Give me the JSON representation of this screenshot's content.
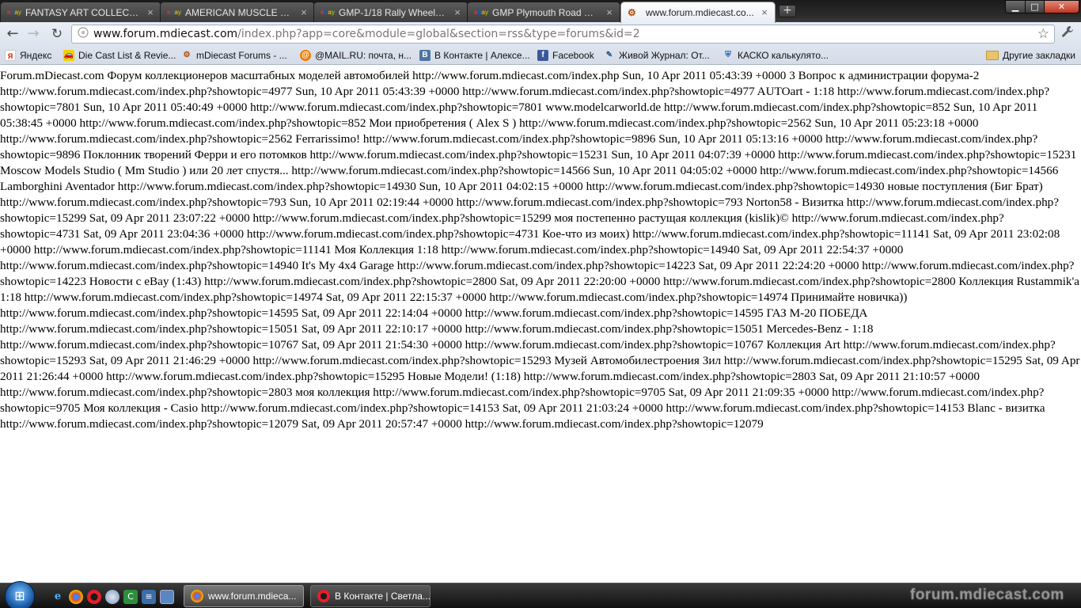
{
  "browser": {
    "tabs": [
      {
        "title": "FANTASY ART COLLECTI...",
        "favicon": "ebay-icon"
      },
      {
        "title": "AMERICAN MUSCLE 197...",
        "favicon": "ebay-icon"
      },
      {
        "title": "GMP-1/18 Rally Wheel & ...",
        "favicon": "ebay-icon"
      },
      {
        "title": "GMP Plymouth Road Ru...",
        "favicon": "ebay-icon"
      },
      {
        "title": "www.forum.mdiecast.co...",
        "favicon": "mdiecast-icon",
        "active": true
      }
    ],
    "tab_close_glyph": "×",
    "new_tab_glyph": "+",
    "window_controls": {
      "minimize": "▁",
      "maximize": "□",
      "close": "✕"
    },
    "toolbar": {
      "back_glyph": "←",
      "forward_glyph": "→",
      "reload_glyph": "↻",
      "url_host": "www.forum.mdiecast.com",
      "url_path": "/index.php?app=core&module=global&section=rss&type=forums&id=2",
      "star_glyph": "☆",
      "wrench_glyph": "🔧"
    },
    "bookmarks": [
      {
        "label": "Яндекс",
        "icon": "yandex-icon",
        "glyph": "Я"
      },
      {
        "label": "Die Cast List & Revie...",
        "icon": "car-icon",
        "glyph": "🚗"
      },
      {
        "label": "mDiecast Forums - ...",
        "icon": "mdiecast-icon",
        "glyph": "⚙"
      },
      {
        "label": "@MAIL.RU: почта, н...",
        "icon": "mailru-icon",
        "glyph": "@"
      },
      {
        "label": "В Контакте | Алексе...",
        "icon": "vk-icon",
        "glyph": "B"
      },
      {
        "label": "Facebook",
        "icon": "facebook-icon",
        "glyph": "f"
      },
      {
        "label": "Живой Журнал: От...",
        "icon": "livejournal-icon",
        "glyph": "✎"
      },
      {
        "label": "КАСКО калькулято...",
        "icon": "kasko-icon",
        "glyph": "⛨"
      }
    ],
    "other_bookmarks": "Другие закладки"
  },
  "page": {
    "rss_text": "Forum.mDiecast.com Форум коллекционеров масштабных моделей автомобилей http://www.forum.mdiecast.com/index.php Sun, 10 Apr 2011 05:43:39 +0000 3 Вопрос к администрации форума-2 http://www.forum.mdiecast.com/index.php?showtopic=4977 Sun, 10 Apr 2011 05:43:39 +0000 http://www.forum.mdiecast.com/index.php?showtopic=4977 AUTOart - 1:18 http://www.forum.mdiecast.com/index.php?showtopic=7801 Sun, 10 Apr 2011 05:40:49 +0000 http://www.forum.mdiecast.com/index.php?showtopic=7801 www.modelcarworld.de http://www.forum.mdiecast.com/index.php?showtopic=852 Sun, 10 Apr 2011 05:38:45 +0000 http://www.forum.mdiecast.com/index.php?showtopic=852 Мои приобретения ( Alex S ) http://www.forum.mdiecast.com/index.php?showtopic=2562 Sun, 10 Apr 2011 05:23:18 +0000 http://www.forum.mdiecast.com/index.php?showtopic=2562 Ferrarissimo! http://www.forum.mdiecast.com/index.php?showtopic=9896 Sun, 10 Apr 2011 05:13:16 +0000 http://www.forum.mdiecast.com/index.php?showtopic=9896 Поклонник творений Ферри и его потомков http://www.forum.mdiecast.com/index.php?showtopic=15231 Sun, 10 Apr 2011 04:07:39 +0000 http://www.forum.mdiecast.com/index.php?showtopic=15231 Moscow Models Studio ( Mm Studio ) или 20 лет спустя... http://www.forum.mdiecast.com/index.php?showtopic=14566 Sun, 10 Apr 2011 04:05:02 +0000 http://www.forum.mdiecast.com/index.php?showtopic=14566 Lamborghini Aventador http://www.forum.mdiecast.com/index.php?showtopic=14930 Sun, 10 Apr 2011 04:02:15 +0000 http://www.forum.mdiecast.com/index.php?showtopic=14930 новые поступления (Биг Брат) http://www.forum.mdiecast.com/index.php?showtopic=793 Sun, 10 Apr 2011 02:19:44 +0000 http://www.forum.mdiecast.com/index.php?showtopic=793 Norton58 - Визитка http://www.forum.mdiecast.com/index.php?showtopic=15299 Sat, 09 Apr 2011 23:07:22 +0000 http://www.forum.mdiecast.com/index.php?showtopic=15299 моя постепенно растущая коллекция (kislik)© http://www.forum.mdiecast.com/index.php?showtopic=4731 Sat, 09 Apr 2011 23:04:36 +0000 http://www.forum.mdiecast.com/index.php?showtopic=4731 Кое-что из моих) http://www.forum.mdiecast.com/index.php?showtopic=11141 Sat, 09 Apr 2011 23:02:08 +0000 http://www.forum.mdiecast.com/index.php?showtopic=11141 Моя Коллекция 1:18 http://www.forum.mdiecast.com/index.php?showtopic=14940 Sat, 09 Apr 2011 22:54:37 +0000 http://www.forum.mdiecast.com/index.php?showtopic=14940 It's My 4x4 Garage http://www.forum.mdiecast.com/index.php?showtopic=14223 Sat, 09 Apr 2011 22:24:20 +0000 http://www.forum.mdiecast.com/index.php?showtopic=14223 Новости с eBay (1:43) http://www.forum.mdiecast.com/index.php?showtopic=2800 Sat, 09 Apr 2011 22:20:00 +0000 http://www.forum.mdiecast.com/index.php?showtopic=2800 Коллекция Rustammik'a 1:18 http://www.forum.mdiecast.com/index.php?showtopic=14974 Sat, 09 Apr 2011 22:15:37 +0000 http://www.forum.mdiecast.com/index.php?showtopic=14974 Принимайте новичка)) http://www.forum.mdiecast.com/index.php?showtopic=14595 Sat, 09 Apr 2011 22:14:04 +0000 http://www.forum.mdiecast.com/index.php?showtopic=14595 ГАЗ М-20 ПОБЕДА http://www.forum.mdiecast.com/index.php?showtopic=15051 Sat, 09 Apr 2011 22:10:17 +0000 http://www.forum.mdiecast.com/index.php?showtopic=15051 Mercedes-Benz - 1:18 http://www.forum.mdiecast.com/index.php?showtopic=10767 Sat, 09 Apr 2011 21:54:30 +0000 http://www.forum.mdiecast.com/index.php?showtopic=10767 Коллекция Art http://www.forum.mdiecast.com/index.php?showtopic=15293 Sat, 09 Apr 2011 21:46:29 +0000 http://www.forum.mdiecast.com/index.php?showtopic=15293 Музей Автомобилестроения Зил http://www.forum.mdiecast.com/index.php?showtopic=15295 Sat, 09 Apr 2011 21:26:44 +0000 http://www.forum.mdiecast.com/index.php?showtopic=15295 Новые Модели! (1:18) http://www.forum.mdiecast.com/index.php?showtopic=2803 Sat, 09 Apr 2011 21:10:57 +0000 http://www.forum.mdiecast.com/index.php?showtopic=2803 моя коллекция http://www.forum.mdiecast.com/index.php?showtopic=9705 Sat, 09 Apr 2011 21:09:35 +0000 http://www.forum.mdiecast.com/index.php?showtopic=9705 Моя коллекция - Casio http://www.forum.mdiecast.com/index.php?showtopic=14153 Sat, 09 Apr 2011 21:03:24 +0000 http://www.forum.mdiecast.com/index.php?showtopic=14153 Blanc - визитка http://www.forum.mdiecast.com/index.php?showtopic=12079 Sat, 09 Apr 2011 20:57:47 +0000 http://www.forum.mdiecast.com/index.php?showtopic=12079"
  },
  "taskbar": {
    "start_glyph": "⊞",
    "quick_launch": [
      {
        "icon": "internet-explorer-icon",
        "glyph": "e"
      },
      {
        "icon": "chrome-icon",
        "glyph": ""
      },
      {
        "icon": "opera-icon",
        "glyph": ""
      },
      {
        "icon": "app-icon",
        "glyph": ""
      },
      {
        "icon": "utorrent-icon",
        "glyph": "C"
      },
      {
        "icon": "app-icon",
        "glyph": "≡"
      },
      {
        "icon": "show-desktop-icon",
        "glyph": ""
      }
    ],
    "windows": [
      {
        "label": "www.forum.mdieca...",
        "icon": "chrome-icon",
        "active": true
      },
      {
        "label": "В Контакте | Светла...",
        "icon": "opera-icon",
        "active": false
      }
    ],
    "watermark_text": "forum.mdiecast.com"
  },
  "colors": {
    "tab_strip": "#2b2b2b",
    "toolbar": "#e3e9f2",
    "page_background": "#ffffff",
    "taskbar": "#1a1a1a"
  }
}
